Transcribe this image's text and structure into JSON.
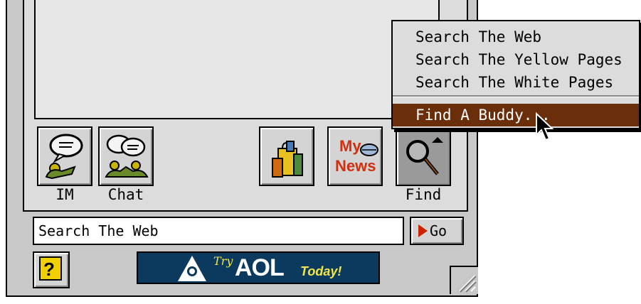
{
  "toolbar": {
    "im_label": "IM",
    "chat_label": "Chat",
    "find_label": "Find",
    "news_text_1": "My",
    "news_text_2": "News"
  },
  "search": {
    "value": "Search The Web",
    "go_label": "Go"
  },
  "help": {
    "symbol": "?"
  },
  "ad": {
    "try": "Try",
    "aol": "AOL",
    "today": "Today!"
  },
  "find_menu": {
    "items": [
      "Search The Web",
      "Search The Yellow Pages",
      "Search The White Pages",
      "Find A Buddy..."
    ],
    "highlighted_index": 3
  },
  "colors": {
    "menu_highlight": "#6a2e0a",
    "ad_background": "#0c3a5e",
    "ad_accent": "#f2e64a",
    "go_arrow": "#cc2200"
  },
  "icons": [
    "im-icon",
    "chat-icon",
    "shopping-icon",
    "my-news-icon",
    "find-magnifier-icon",
    "help-icon",
    "aol-logo-icon",
    "resize-grip-icon",
    "mouse-cursor-icon"
  ]
}
